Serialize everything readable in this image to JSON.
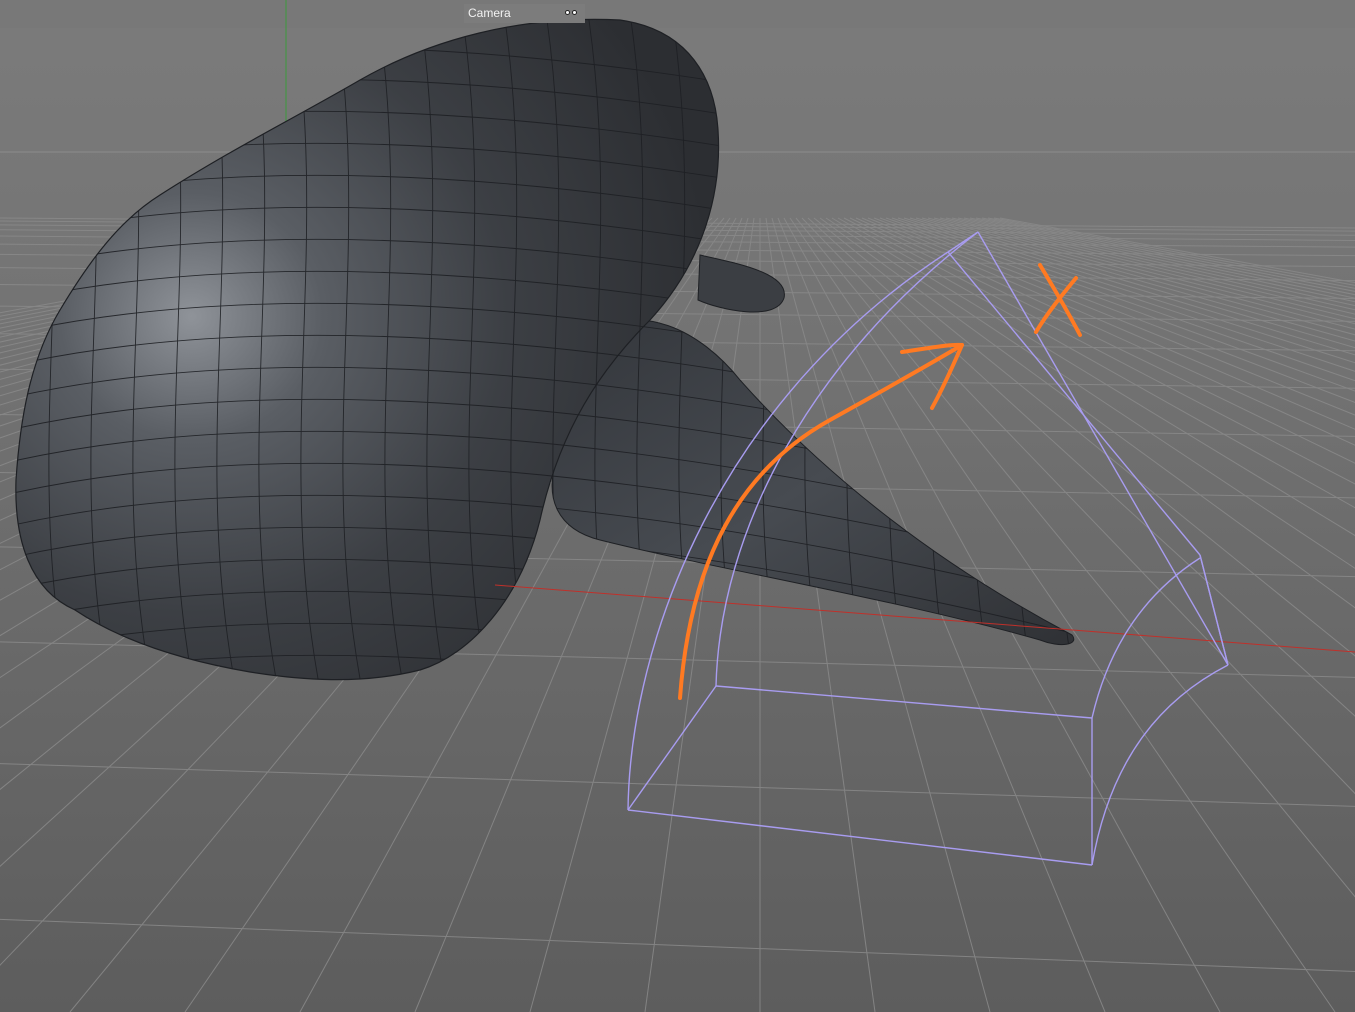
{
  "viewport": {
    "camera_label": "Camera",
    "camera_icon": "camera-link-icon",
    "colors": {
      "background_top": "#7c7c7c",
      "background_bottom": "#5e5e5e",
      "grid": "#8a8a8a",
      "mesh": "#3a3d42",
      "wire": "#1e2024",
      "x_axis": "#c0302a",
      "y_axis": "#3c9a3c",
      "deformer_cage": "#a89cf0",
      "annotation": "#ff7a22"
    },
    "annotation_text": "X"
  }
}
